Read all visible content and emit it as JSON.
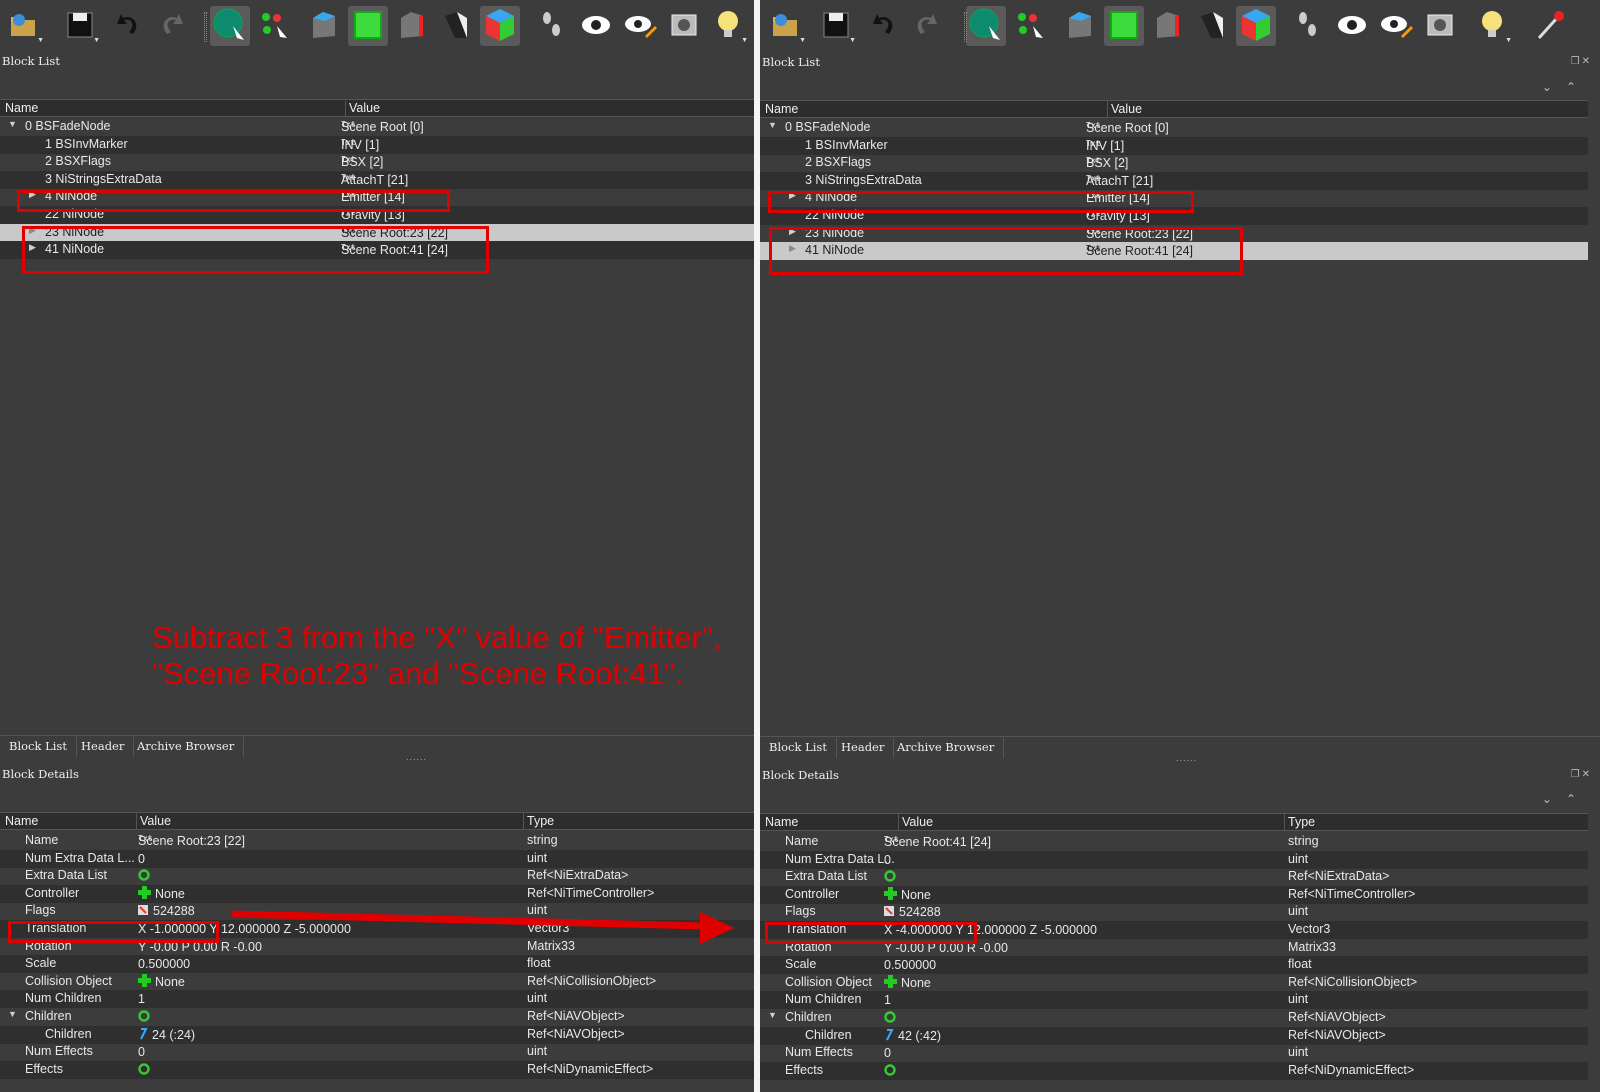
{
  "toolbar_icons": [
    "open-folder-icon",
    "save-icon",
    "undo-icon",
    "redo-icon",
    "sphere-select-icon",
    "nodes-select-icon",
    "cube-solid-icon",
    "cube-green-icon",
    "cube-red-icon",
    "cube-wire-icon",
    "cube-color-icon",
    "footsteps-icon",
    "eye-icon",
    "eye-edit-icon",
    "camera-icon",
    "lightbulb-icon",
    "wand-icon"
  ],
  "colors": {
    "highlight_red": "#e00000",
    "selection": "#c9c9c9",
    "panel_bg": "#3c3c3c",
    "header_bg": "#2d2d2d"
  },
  "left": {
    "block_list_title": "Block List",
    "columns": {
      "name": "Name",
      "value": "Value"
    },
    "rows": [
      {
        "name": "0 BSFadeNode",
        "value": "Scene Root [0]"
      },
      {
        "name": "1 BSInvMarker",
        "value": "INV [1]"
      },
      {
        "name": "2 BSXFlags",
        "value": "BSX [2]"
      },
      {
        "name": "3 NiStringsExtraData",
        "value": "AttachT [21]"
      },
      {
        "name": "4 NiNode",
        "value": "Emitter [14]"
      },
      {
        "name": "22 NiNode",
        "value": "Gravity [13]"
      },
      {
        "name": "23 NiNode",
        "value": "Scene Root:23 [22]"
      },
      {
        "name": "41 NiNode",
        "value": "Scene Root:41 [24]"
      }
    ],
    "tabs": [
      "Block List",
      "Header",
      "Archive Browser"
    ],
    "splitter": "......",
    "details_title": "Block Details",
    "detail_columns": {
      "name": "Name",
      "value": "Value",
      "type": "Type"
    },
    "details": [
      {
        "name": "Name",
        "value": "Scene Root:23 [22]",
        "type": "string"
      },
      {
        "name": "Num Extra Data L...",
        "value": "0",
        "type": "uint"
      },
      {
        "name": "Extra Data List",
        "value": "",
        "type": "Ref<NiExtraData>"
      },
      {
        "name": "Controller",
        "value": "None",
        "type": "Ref<NiTimeController>"
      },
      {
        "name": "Flags",
        "value": "524288",
        "type": "uint"
      },
      {
        "name": "Translation",
        "value": "X -1.000000 Y 12.000000 Z -5.000000",
        "type": "Vector3"
      },
      {
        "name": "Rotation",
        "value": "Y -0.00 P 0.00 R -0.00",
        "type": "Matrix33"
      },
      {
        "name": "Scale",
        "value": "0.500000",
        "type": "float"
      },
      {
        "name": "Collision Object",
        "value": "None",
        "type": "Ref<NiCollisionObject>"
      },
      {
        "name": "Num Children",
        "value": "1",
        "type": "uint"
      },
      {
        "name": "Children",
        "value": "",
        "type": "Ref<NiAVObject>"
      },
      {
        "name": "Children",
        "value": "24 (:24)",
        "type": "Ref<NiAVObject>"
      },
      {
        "name": "Num Effects",
        "value": "0",
        "type": "uint"
      },
      {
        "name": "Effects",
        "value": "",
        "type": "Ref<NiDynamicEffect>"
      }
    ]
  },
  "right": {
    "block_list_title": "Block List",
    "columns": {
      "name": "Name",
      "value": "Value"
    },
    "rows": [
      {
        "name": "0 BSFadeNode",
        "value": "Scene Root [0]"
      },
      {
        "name": "1 BSInvMarker",
        "value": "INV [1]"
      },
      {
        "name": "2 BSXFlags",
        "value": "BSX [2]"
      },
      {
        "name": "3 NiStringsExtraData",
        "value": "AttachT [21]"
      },
      {
        "name": "4 NiNode",
        "value": "Emitter [14]"
      },
      {
        "name": "22 NiNode",
        "value": "Gravity [13]"
      },
      {
        "name": "23 NiNode",
        "value": "Scene Root:23 [22]"
      },
      {
        "name": "41 NiNode",
        "value": "Scene Root:41 [24]"
      }
    ],
    "tabs": [
      "Block List",
      "Header",
      "Archive Browser"
    ],
    "splitter": "......",
    "details_title": "Block Details",
    "detail_columns": {
      "name": "Name",
      "value": "Value",
      "type": "Type"
    },
    "details": [
      {
        "name": "Name",
        "value": "Scene Root:41 [24]",
        "type": "string"
      },
      {
        "name": "Num Extra Data L...",
        "value": "0",
        "type": "uint"
      },
      {
        "name": "Extra Data List",
        "value": "",
        "type": "Ref<NiExtraData>"
      },
      {
        "name": "Controller",
        "value": "None",
        "type": "Ref<NiTimeController>"
      },
      {
        "name": "Flags",
        "value": "524288",
        "type": "uint"
      },
      {
        "name": "Translation",
        "value": "X -4.000000 Y 12.000000 Z -5.000000",
        "type": "Vector3"
      },
      {
        "name": "Rotation",
        "value": "Y -0.00 P 0.00 R -0.00",
        "type": "Matrix33"
      },
      {
        "name": "Scale",
        "value": "0.500000",
        "type": "float"
      },
      {
        "name": "Collision Object",
        "value": "None",
        "type": "Ref<NiCollisionObject>"
      },
      {
        "name": "Num Children",
        "value": "1",
        "type": "uint"
      },
      {
        "name": "Children",
        "value": "",
        "type": "Ref<NiAVObject>"
      },
      {
        "name": "Children",
        "value": "42 (:42)",
        "type": "Ref<NiAVObject>"
      },
      {
        "name": "Num Effects",
        "value": "0",
        "type": "uint"
      },
      {
        "name": "Effects",
        "value": "",
        "type": "Ref<NiDynamicEffect>"
      }
    ]
  },
  "annotation": {
    "line1": "Subtract 3 from the \"X\" value of \"Emitter\",",
    "line2": "\"Scene Root:23\" and  \"Scene Root:41\"."
  }
}
